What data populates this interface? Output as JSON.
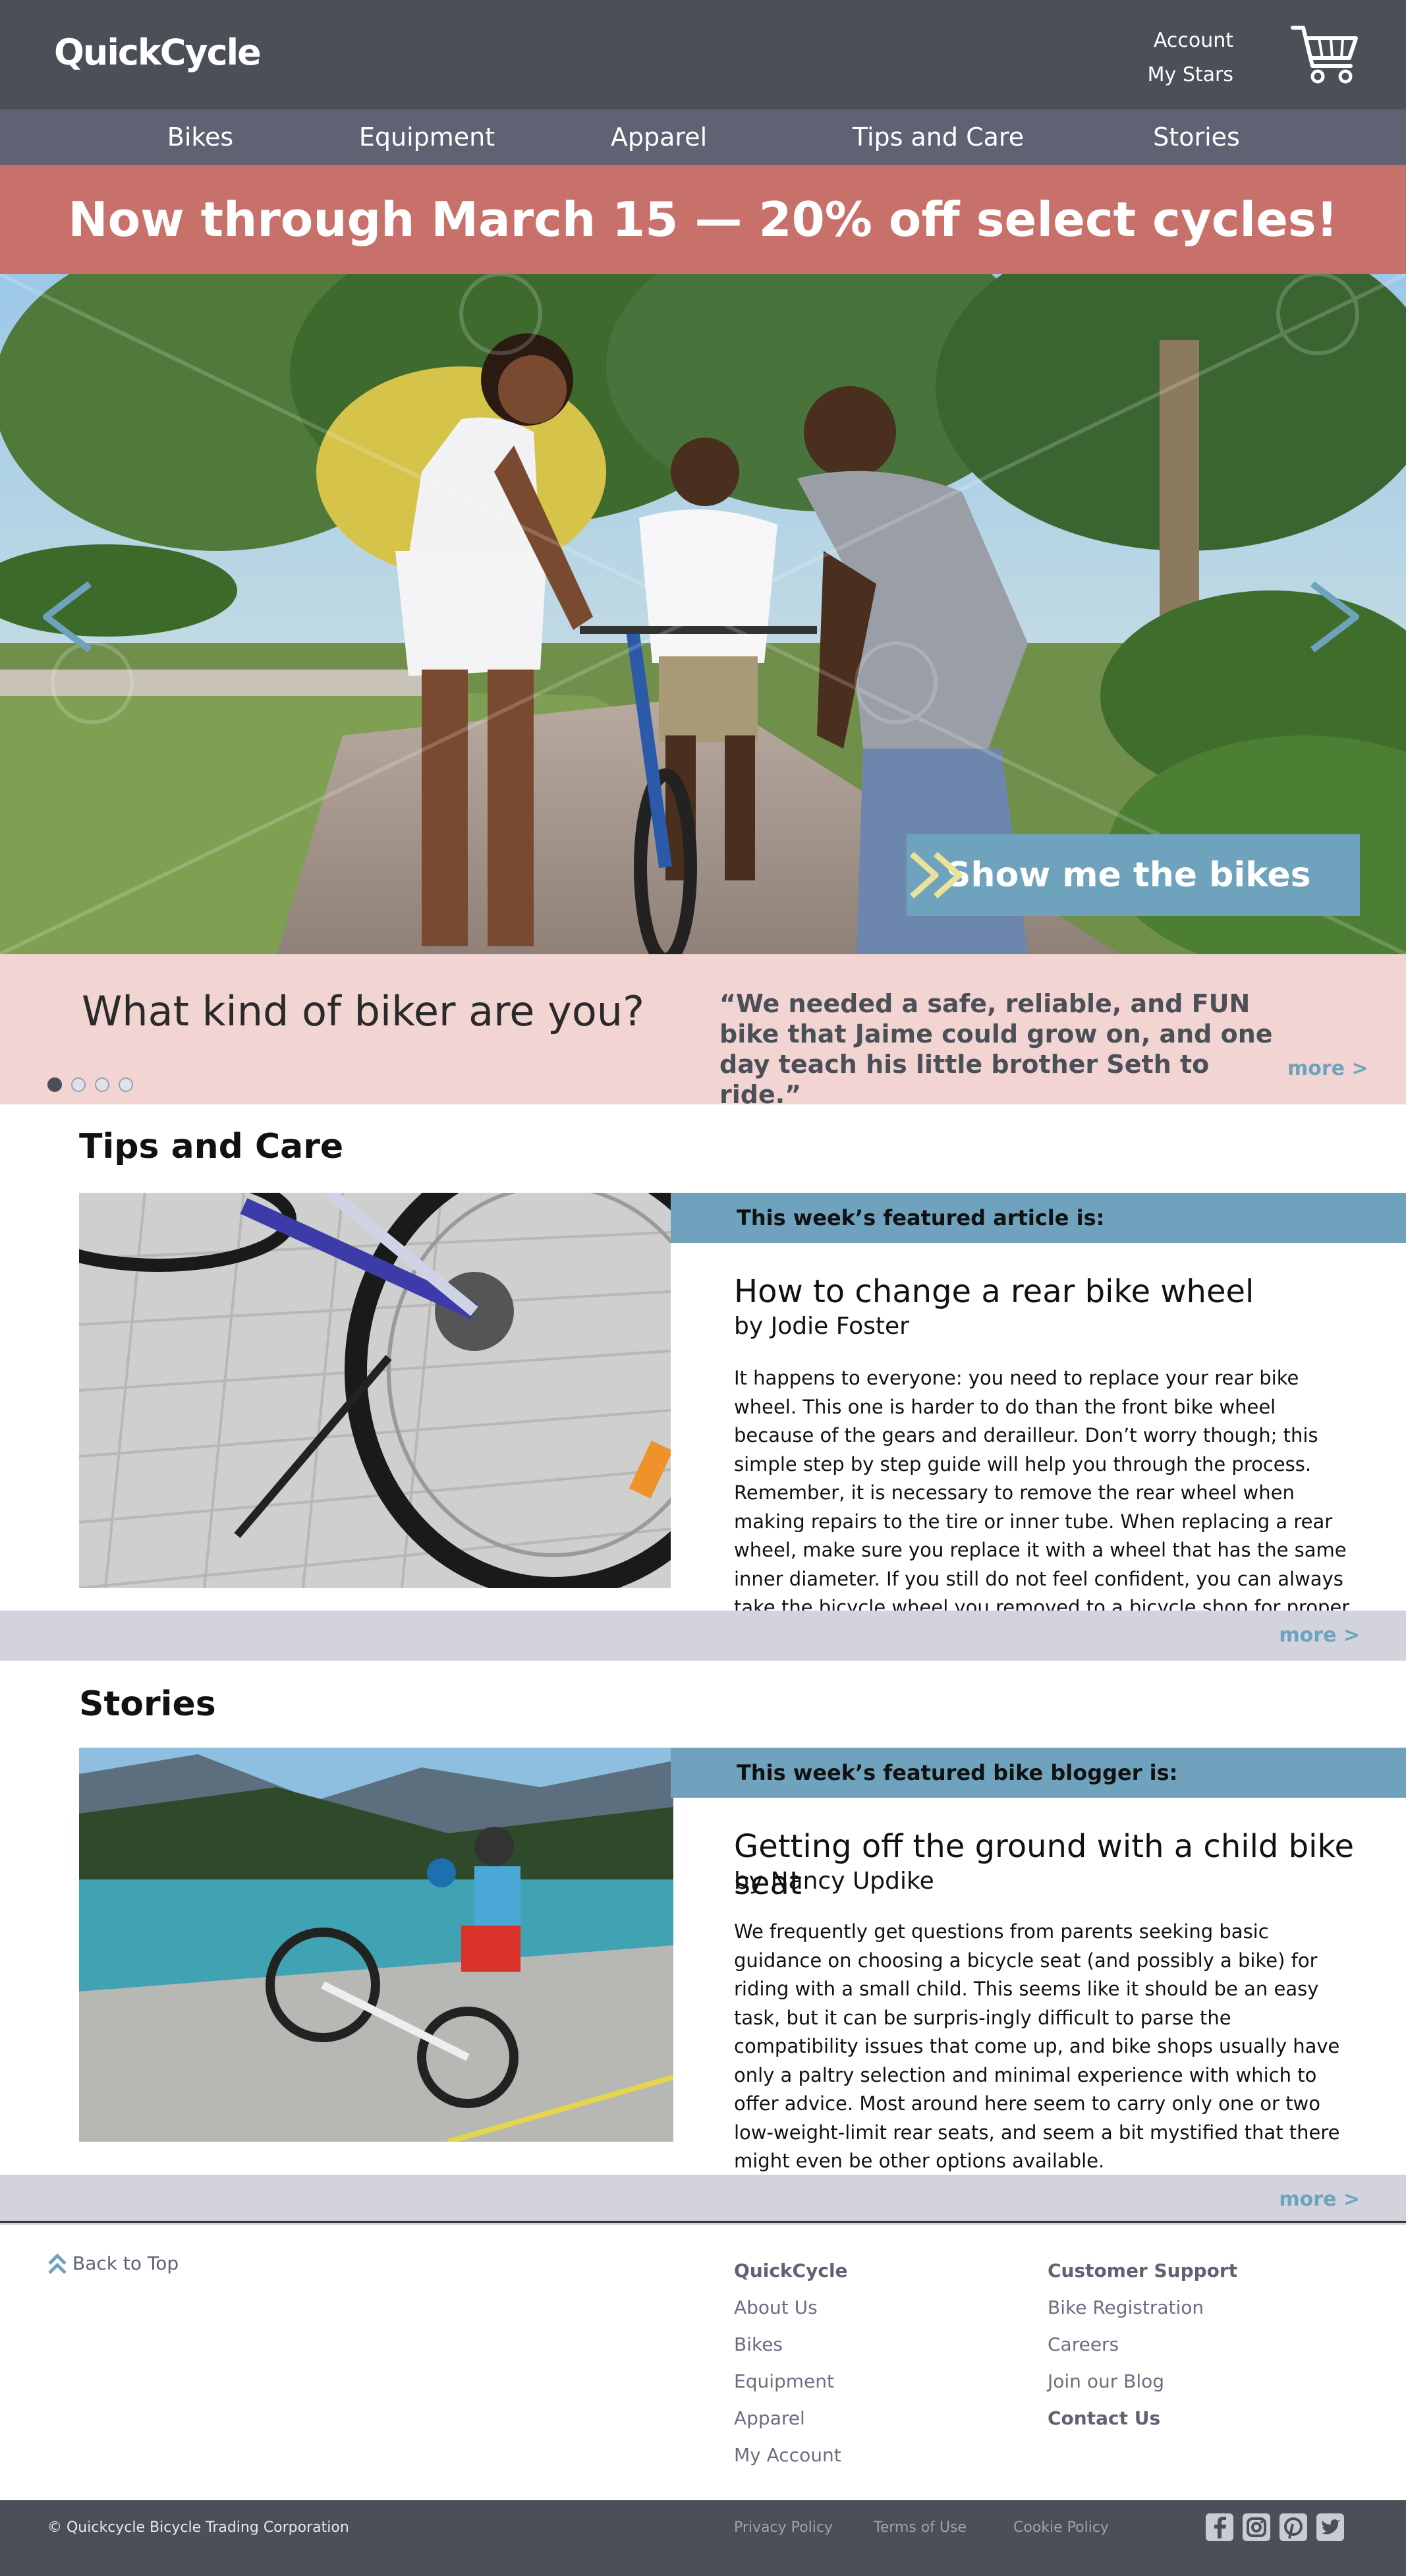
{
  "header": {
    "logo": "QuickCycle",
    "account_label": "Account",
    "stars_label": "My Stars"
  },
  "nav": {
    "items": [
      "Bikes",
      "Equipment",
      "Apparel",
      "Tips and Care",
      "Stories"
    ]
  },
  "promo": {
    "text": "Now through March 15 — 20% off select cycles!"
  },
  "hero": {
    "cta_label": "Show me the bikes"
  },
  "testimonial": {
    "question": "What kind of biker are you?",
    "quote": "“We needed a safe, reliable, and FUN bike that Jaime could grow on, and one day teach his little brother Seth to ride.”",
    "more": "more >",
    "slide_count": 4,
    "active_slide": 1
  },
  "tips": {
    "section_title": "Tips and Care",
    "featured_label": "This week’s featured article is:",
    "title": "How to change a rear bike wheel",
    "byline": "by Jodie Foster",
    "body": "It happens to everyone: you need to replace your rear bike wheel. This one is harder to do than the front bike wheel because of the gears and derailleur. Don’t worry though; this simple step by step guide will help you through the process. Remember, it is necessary to remove the rear wheel when making repairs to the tire or inner tube. When replacing a rear wheel, make sure you replace it with a wheel that has the same inner diameter. If you still do not feel confident, you can always take the bicycle wheel you removed to a bicycle shop for proper wheel replacement.",
    "more": "more >"
  },
  "stories": {
    "section_title": "Stories",
    "featured_label": "This week’s featured bike blogger is:",
    "title": "Getting off the ground with a child bike seat",
    "byline": "by Nancy Updike",
    "body": "We frequently get questions from parents seeking basic guidance on choosing a bicycle seat (and possibly a bike) for riding with a small child.  This seems like it should be an easy task, but it can be surpris-ingly difficult to parse the compatibility issues that come up, and bike shops usually have only a paltry selection and minimal experience with which to offer advice.  Most around here seem to carry only one or two low-weight-limit rear seats, and seem a bit mystified that there might even be other options available.",
    "more": "more >"
  },
  "footer": {
    "back_to_top": "Back to Top",
    "col1": {
      "head": "QuickCycle",
      "links": [
        "About Us",
        "Bikes",
        "Equipment",
        "Apparel",
        "My Account"
      ]
    },
    "col2": {
      "head": "Customer Support",
      "links": [
        "Bike Registration",
        "Careers",
        "Join our Blog"
      ],
      "bold_link": "Contact Us"
    },
    "copyright": "© Quickcycle Bicycle Trading Corporation",
    "legal": [
      "Privacy Policy",
      "Terms of Use",
      "Cookie Policy"
    ],
    "social": [
      "facebook-icon",
      "instagram-icon",
      "pinterest-icon",
      "twitter-icon"
    ]
  },
  "colors": {
    "header": "#4b4f58",
    "nav": "#5f6273",
    "promo": "#c8716a",
    "accent": "#6fa3bd",
    "band": "#f2d5d3",
    "more_bar": "#d2d3dd"
  }
}
